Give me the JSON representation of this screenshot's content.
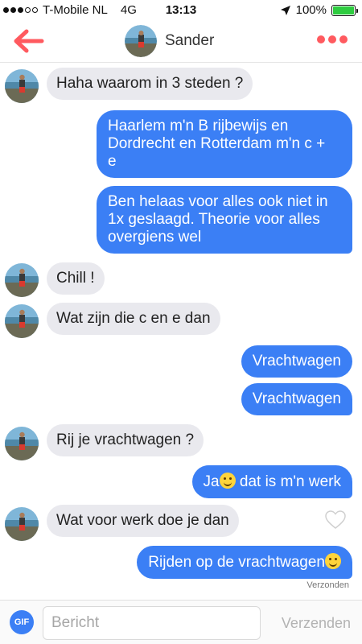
{
  "status_bar": {
    "carrier": "T-Mobile NL",
    "network": "4G",
    "time": "13:13",
    "battery": "100%",
    "signal_bars_filled": 3,
    "signal_bars_total": 5,
    "battery_level": 1.0
  },
  "header": {
    "contact_name": "Sander",
    "back_icon": "arrow-left-icon",
    "more_icon": "more-dots-icon",
    "accent_color": "#ff5a5f"
  },
  "messages": [
    {
      "direction": "in",
      "text": "Haha waarom in 3 steden ?"
    },
    {
      "direction": "out",
      "text": "Haarlem m'n B rijbewijs en\nDordrecht en Rotterdam m'n c +\ne"
    },
    {
      "direction": "out",
      "text": "Ben helaas voor alles ook niet in\n1x geslaagd. Theorie voor alles\novergiens wel"
    },
    {
      "direction": "in",
      "text": "Chill !"
    },
    {
      "direction": "in",
      "text": "Wat zijn die c en e dan"
    },
    {
      "direction": "out",
      "text": "Vrachtwagen"
    },
    {
      "direction": "out",
      "text": "Vrachtwagen"
    },
    {
      "direction": "in",
      "text": "Rij je vrachtwagen ?"
    },
    {
      "direction": "out",
      "text_before": "Ja",
      "emoji": "smiling-face-emoji",
      "text_after": " dat is m'n werk"
    },
    {
      "direction": "in",
      "text": "Wat voor werk doe je dan"
    },
    {
      "direction": "out",
      "text": "Rijden op de vrachtwagen",
      "emoji": "grinning-sweat-emoji"
    }
  ],
  "sent_status": "Verzonden",
  "compose": {
    "gif_label": "GIF",
    "placeholder": "Bericht",
    "value": "",
    "send_label": "Verzenden"
  },
  "colors": {
    "outgoing_bubble": "#3b7ff5",
    "incoming_bubble": "#e9e9ee"
  }
}
